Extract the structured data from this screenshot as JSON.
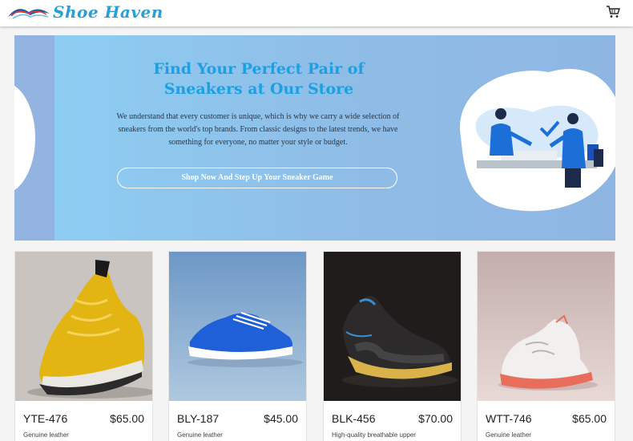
{
  "brand": {
    "name": "Shoe Haven"
  },
  "header": {
    "cart_icon": "cart-icon"
  },
  "hero": {
    "title": "Find Your Perfect Pair of Sneakers at Our Store",
    "description": "We understand that every customer is unique, which is why we carry a wide selection of sneakers from the world's top brands. From classic designs to the latest trends, we have something for everyone, no matter your style or budget.",
    "cta_label": "Shop Now And Step Up Your Sneaker Game"
  },
  "products": [
    {
      "name": "YTE-476",
      "price": "$65.00",
      "description": "Genuine leather",
      "image": "yellow-sneaker"
    },
    {
      "name": "BLY-187",
      "price": "$45.00",
      "description": "Genuine leather",
      "image": "blue-sneaker"
    },
    {
      "name": "BLK-456",
      "price": "$70.00",
      "description": "High-quality breathable upper",
      "image": "black-sneaker"
    },
    {
      "name": "WTT-746",
      "price": "$65.00",
      "description": "Genuine leather",
      "image": "white-sneaker"
    }
  ],
  "colors": {
    "accent": "#1aa0e3",
    "hero_bg": "#8fbde6",
    "text": "#222222"
  }
}
